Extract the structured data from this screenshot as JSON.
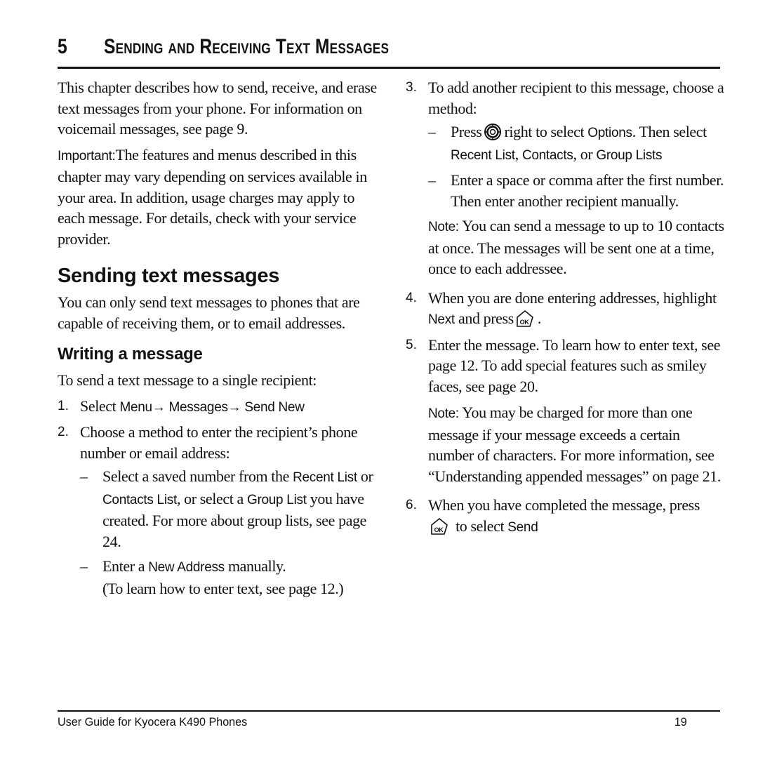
{
  "chapter": {
    "number": "5",
    "title": "Sending and Receiving Text Messages"
  },
  "intro": {
    "paragraph": "This chapter describes how to send, receive, and erase text messages from your phone. For information on voicemail messages, see page 9.",
    "important_label": "Important:",
    "important_text": "The features and menus described in this chapter may vary depending on services available in your area. In addition, usage charges may apply to each message. For details, check with your service provider."
  },
  "section": {
    "title": "Sending text messages",
    "paragraph": "You can only send text messages to phones that are capable of receiving them, or to email addresses."
  },
  "subsection": {
    "title": "Writing a message",
    "lead": "To send a text message to a single recipient:"
  },
  "steps": {
    "s1": {
      "num": "1.",
      "pre": "Select ",
      "path": "Menu→ Messages→ Send New"
    },
    "s2": {
      "num": "2.",
      "text": "Choose a method to enter the recipient’s phone number or email address:",
      "sub1": {
        "t1": "Select a saved number from the ",
        "ui1": "Recent List",
        "t2": " or ",
        "ui2": "Contacts List",
        "t3": ", or select a ",
        "ui3": "Group List",
        "t4": " you have created. For more about group lists, see page 24."
      },
      "sub2": {
        "t1": "Enter a ",
        "ui1": "New Address",
        "t2": " manually.",
        "t3": "(To learn how to enter text, see page 12.)"
      }
    },
    "s3": {
      "num": "3.",
      "text": "To add another recipient to this message, choose a method:",
      "sub1": {
        "t1": "Press",
        "t2": "right to select ",
        "ui1": "Options",
        "t3": ". Then select ",
        "ui2": "Recent List",
        "t4": ", ",
        "ui3": "Contacts",
        "t5": ", or ",
        "ui4": "Group Lists"
      },
      "sub2": "Enter a space or comma after the first number. Then enter another recipient manually.",
      "note_label": "Note:",
      "note_text": " You can send a message to up to 10 contacts at once. The messages will be sent one at a time, once to each addressee."
    },
    "s4": {
      "num": "4.",
      "t1": "When you are done entering addresses, highlight ",
      "ui1": "Next",
      "t2": " and press",
      "t3": "."
    },
    "s5": {
      "num": "5.",
      "text": "Enter the message. To learn how to enter text, see page 12. To add special features such as smiley faces, see page 20.",
      "note_label": "Note:",
      "note_text": " You may be charged for more than one message if your message exceeds a certain number of characters. For more information, see “Understanding appended messages” on page 21."
    },
    "s6": {
      "num": "6.",
      "t1": "When you have completed the message, press",
      "t2": " to select ",
      "ui1": "Send"
    }
  },
  "icons": {
    "nav_key": "navigation-key-icon",
    "ok_key": "ok-key-icon"
  },
  "footer": {
    "title": "User Guide for Kyocera K490 Phones",
    "page": "19"
  }
}
